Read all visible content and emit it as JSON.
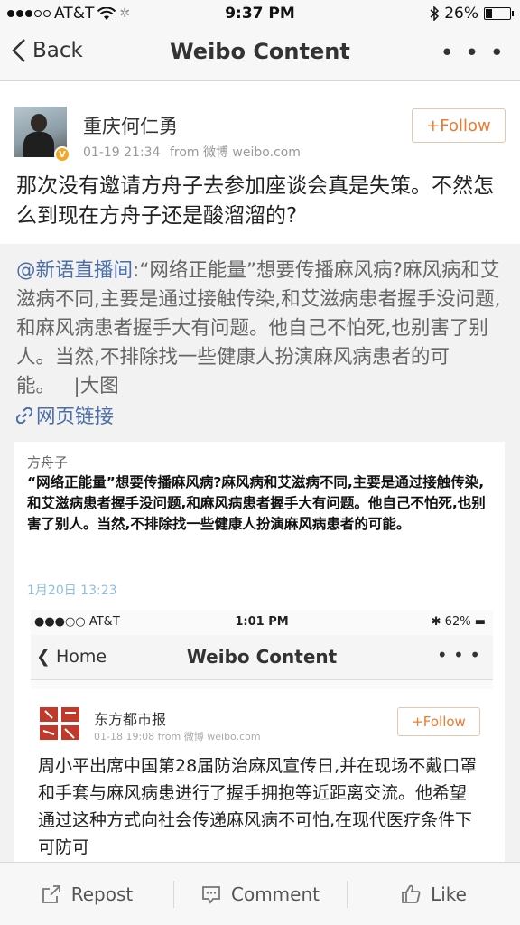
{
  "status_bar": {
    "carrier": "AT&T",
    "time": "9:37 PM",
    "battery": "26%",
    "battery_level": 0.26
  },
  "nav": {
    "back_label": "Back",
    "title": "Weibo Content"
  },
  "author": {
    "name": "重庆何仁勇",
    "time": "01-19 21:34",
    "source": "from 微博 weibo.com",
    "verified_mark": "V",
    "follow_label": "+Follow"
  },
  "post": {
    "text": "那次没有邀请方舟子去参加座谈会真是失策。不然怎么到现在方舟子还是酸溜溜的?"
  },
  "retweet": {
    "mention": "@新语直播间",
    "text": ":“网络正能量”想要传播麻风病?麻风病和艾滋病不同,主要是通过接触传染,和艾滋病患者握手没问题,和麻风病患者握手大有问题。他自己不怕死,也别害了别人。当然,不排除找一些健康人扮演麻风病患者的可能。",
    "big_image_label": "|大图",
    "link_label": "网页链接"
  },
  "embed": {
    "author": "方舟子",
    "quote": "“网络正能量”想要传播麻风病?麻风病和艾滋病不同,主要是通过接触传染,和艾滋病患者握手没问题,和麻风病患者握手大有问题。他自己不怕死,也别害了别人。当然,不排除找一些健康人扮演麻风病患者的可能。",
    "date": "1月20日 13:23",
    "inner": {
      "carrier": "AT&T",
      "time": "1:01 PM",
      "battery": "62%",
      "back_label": "Home",
      "title": "Weibo Content",
      "author_name": "东方都市报",
      "meta": "01-18 19:08 from 微博 weibo.com",
      "follow_label": "+Follow",
      "text": "周小平出席中国第28届防治麻风宣传日,并在现场不戴口罩和手套与麻风病患进行了握手拥抱等近距离交流。他希望通过这种方式向社会传递麻风病不可怕,在现代医疗条件下可防可"
    }
  },
  "toolbar": {
    "repost": "Repost",
    "comment": "Comment",
    "like": "Like"
  },
  "colors": {
    "accent_link": "#4a6ea9",
    "follow_orange": "#f07a2e",
    "retweet_bg": "#f2f2f2"
  },
  "icons": [
    "back-chevron-icon",
    "more-icon",
    "wifi-icon",
    "bluetooth-icon",
    "battery-icon",
    "link-icon",
    "repost-icon",
    "comment-icon",
    "like-icon"
  ]
}
